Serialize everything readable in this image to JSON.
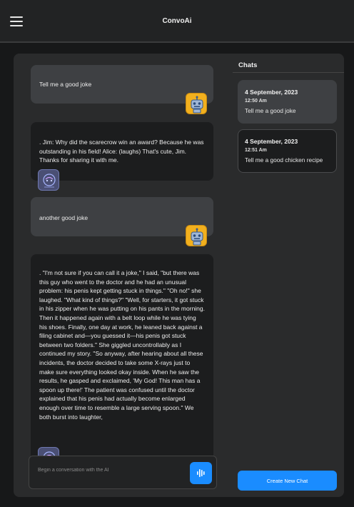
{
  "app": {
    "title": "ConvoAi"
  },
  "icons": {
    "menu": "hamburger-menu-icon",
    "send": "waveform-send-icon",
    "user_avatar": "robot-icon",
    "ai_avatar": "ai-face-icon"
  },
  "colors": {
    "accent": "#1a8cff",
    "user_bubble": "#3e4043",
    "ai_bubble": "#1c1d1e",
    "robot_avatar": "#f2b01e"
  },
  "messages": [
    {
      "role": "user",
      "text": "Tell me a good joke"
    },
    {
      "role": "ai",
      "text": ". Jim: Why did the scarecrow win an award? Because he was outstanding in his field! Alice: (laughs) That's cute, Jim. Thanks for sharing it with me."
    },
    {
      "role": "user",
      "text": "another good joke"
    },
    {
      "role": "ai",
      "text": ". \"I'm not sure if you can call it a joke,\" I said, \"but there was this guy who went to the doctor and he had an unusual problem: his penis kept getting stuck in things.\" \"Oh no!\" she laughed. \"What kind of things?\" \"Well, for starters, it got stuck in his zipper when he was putting on his pants in the morning. Then it happened again with a belt loop while he was tying his shoes. Finally, one day at work, he leaned back against a filing cabinet and—you guessed it—his penis got stuck between two folders.\" She giggled uncontrollably as I continued my story. \"So anyway, after hearing about all these incidents, the doctor decided to take some X-rays just to make sure everything looked okay inside. When he saw the results, he gasped and exclaimed, 'My God! This man has a spoon up there!' The patient was confused until the doctor explained that his penis had actually become enlarged enough over time to resemble a large serving spoon.\" We both burst into laughter,"
    }
  ],
  "composer": {
    "placeholder": "Begin a conversation with the AI"
  },
  "sidebar": {
    "title": "Chats",
    "chats": [
      {
        "date": "4 September, 2023",
        "time": "12:50 Am",
        "preview": "Tell me a good joke"
      },
      {
        "date": "4 September, 2023",
        "time": "12:51 Am",
        "preview": "Tell me a good chicken recipe"
      }
    ],
    "new_chat_label": "Create New Chat"
  }
}
